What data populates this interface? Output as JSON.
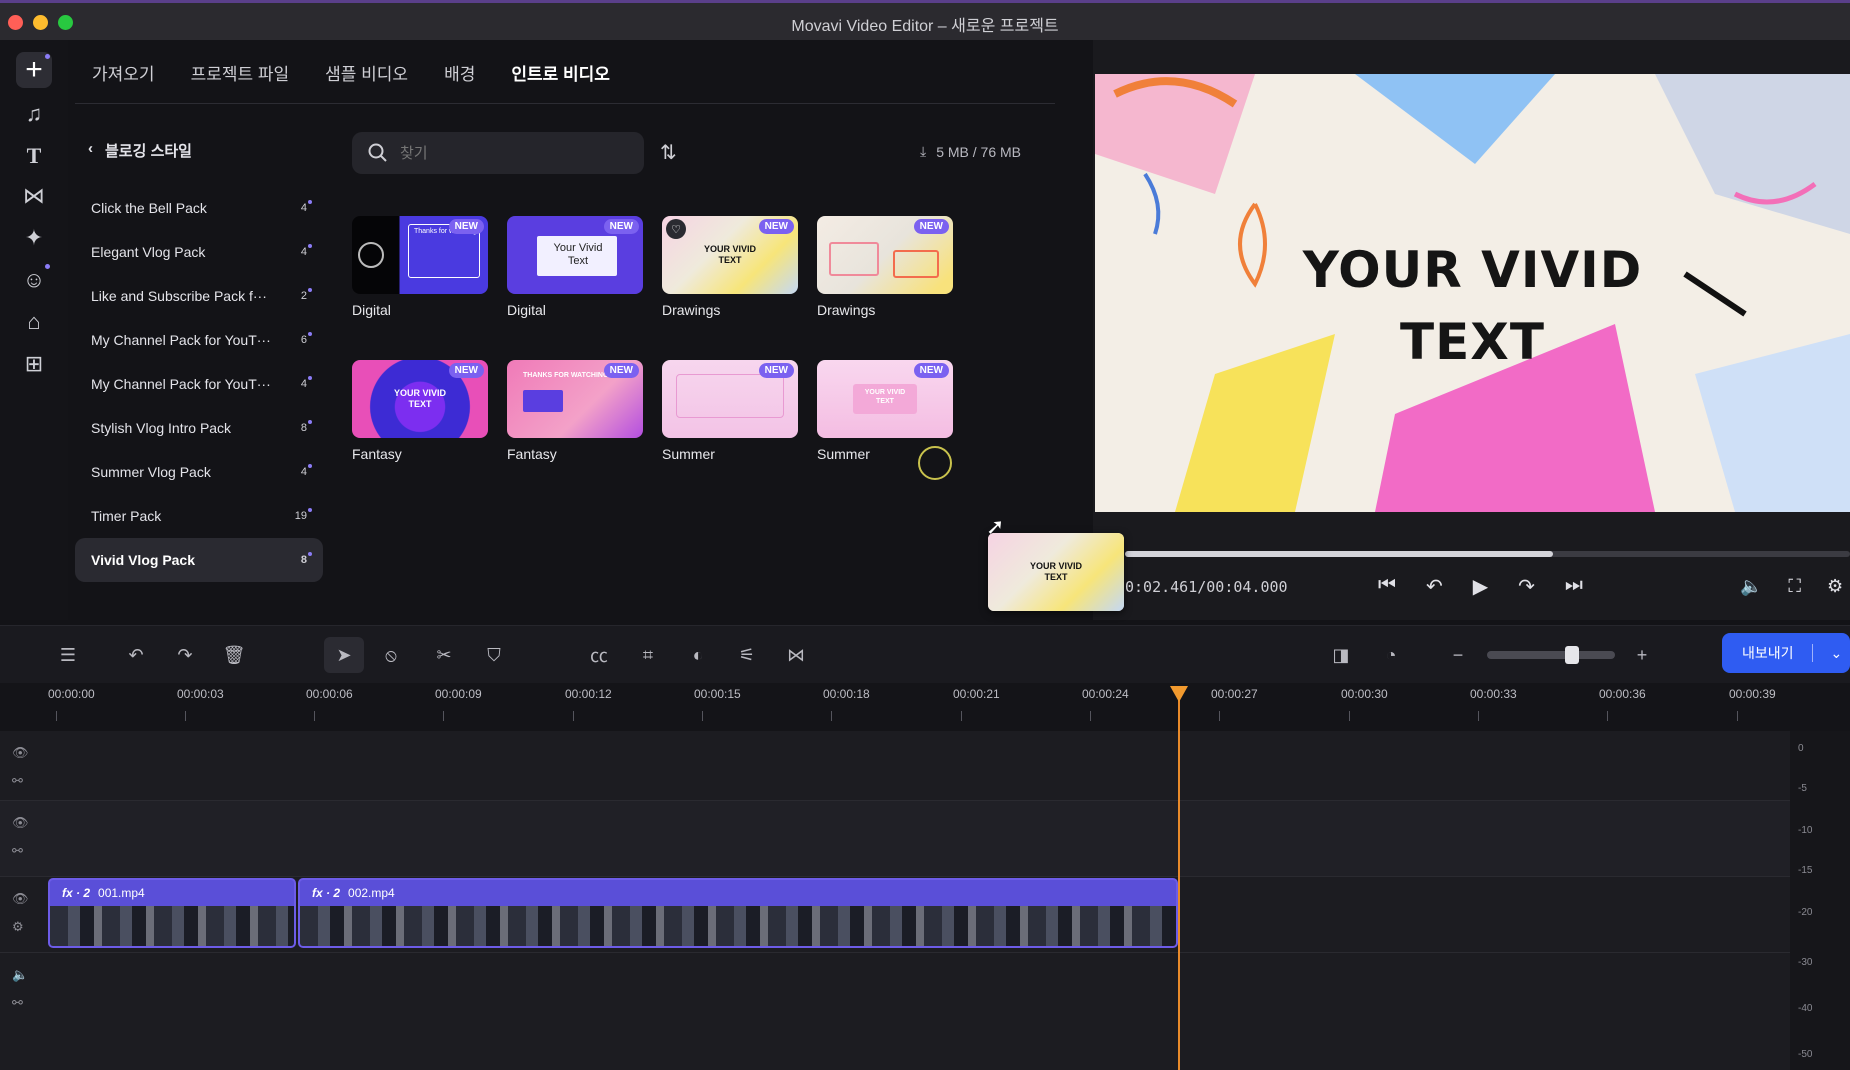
{
  "window": {
    "title": "Movavi Video Editor – 새로운 프로젝트"
  },
  "tabs": [
    {
      "label": "가져오기"
    },
    {
      "label": "프로젝트 파일"
    },
    {
      "label": "샘플 비디오"
    },
    {
      "label": "배경"
    },
    {
      "label": "인트로 비디오"
    }
  ],
  "category_back": {
    "label": "블로깅 스타일"
  },
  "categories": [
    {
      "name": "Click the Bell Pack",
      "count": "4"
    },
    {
      "name": "Elegant Vlog Pack",
      "count": "4"
    },
    {
      "name": "Like and Subscribe Pack f···",
      "count": "2"
    },
    {
      "name": "My Channel Pack for YouT···",
      "count": "6"
    },
    {
      "name": "My Channel Pack for YouT···",
      "count": "4"
    },
    {
      "name": "Stylish Vlog Intro Pack",
      "count": "8"
    },
    {
      "name": "Summer Vlog Pack",
      "count": "4"
    },
    {
      "name": "Timer Pack",
      "count": "19"
    },
    {
      "name": "Vivid Vlog Pack",
      "count": "8"
    }
  ],
  "search": {
    "placeholder": "찾기"
  },
  "storage": {
    "text": "5 MB / 76 MB"
  },
  "badge_new": "NEW",
  "thumbnails": [
    {
      "label": "Digital",
      "thumb_text": "Thanks for watching"
    },
    {
      "label": "Digital",
      "thumb_text": "Your Vivid Text"
    },
    {
      "label": "Drawings",
      "thumb_text": "YOUR VIVID TEXT"
    },
    {
      "label": "Drawings",
      "thumb_text": ""
    },
    {
      "label": "Fantasy",
      "thumb_text": "YOUR VIVID TEXT"
    },
    {
      "label": "Fantasy",
      "thumb_text": "THANKS FOR WATCHING"
    },
    {
      "label": "Summer",
      "thumb_text": ""
    },
    {
      "label": "Summer",
      "thumb_text": "YOUR VIVID TEXT"
    }
  ],
  "preview": {
    "line1": "YOUR VIVID",
    "line2": "TEXT",
    "progress_fraction": 0.59,
    "timecode": "0:02.461/00:04.000",
    "drag_thumb_text": "YOUR VIVID TEXT"
  },
  "export": {
    "label": "내보내기"
  },
  "ruler": [
    "00:00:00",
    "00:00:03",
    "00:00:06",
    "00:00:09",
    "00:00:12",
    "00:00:15",
    "00:00:18",
    "00:00:21",
    "00:00:24",
    "00:00:27",
    "00:00:30",
    "00:00:33",
    "00:00:36",
    "00:00:39"
  ],
  "clips": [
    {
      "fx": "fx · 2",
      "name": "001.mp4"
    },
    {
      "fx": "fx · 2",
      "name": "002.mp4"
    }
  ],
  "meter_labels": [
    "0",
    "-5",
    "-10",
    "-15",
    "-20",
    "-30",
    "-40",
    "-50"
  ],
  "colors": {
    "accent": "#7b61f0",
    "export": "#2f5cf2",
    "playhead": "#e98a2a",
    "clip": "#5a4fd8"
  }
}
